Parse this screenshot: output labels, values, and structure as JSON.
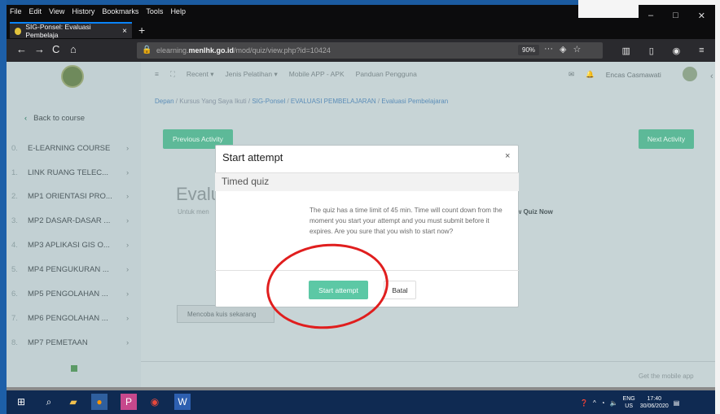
{
  "menubar": [
    "File",
    "Edit",
    "View",
    "History",
    "Bookmarks",
    "Tools",
    "Help"
  ],
  "tab": {
    "title": "SIG-Ponsel: Evaluasi Pembelaja",
    "close": "×"
  },
  "newtab": "+",
  "nav": {
    "back": "←",
    "forward": "→",
    "reload": "C",
    "home": "⌂"
  },
  "url": {
    "prefix": "elearning.",
    "domain": "menlhk.go.id",
    "path": "/mod/quiz/view.php?id=10424",
    "zoom": "90%",
    "more": "···"
  },
  "sidebar": {
    "back": "Back to course",
    "items": [
      {
        "num": "0.",
        "label": "E-LEARNING COURSE"
      },
      {
        "num": "1.",
        "label": "LINK RUANG TELEC..."
      },
      {
        "num": "2.",
        "label": "MP1 ORIENTASI PRO..."
      },
      {
        "num": "3.",
        "label": "MP2 DASAR-DASAR ..."
      },
      {
        "num": "4.",
        "label": "MP3 APLIKASI GIS O..."
      },
      {
        "num": "5.",
        "label": "MP4 PENGUKURAN ..."
      },
      {
        "num": "6.",
        "label": "MP5 PENGOLAHAN ..."
      },
      {
        "num": "7.",
        "label": "MP6 PENGOLAHAN ..."
      },
      {
        "num": "8.",
        "label": "MP7 PEMETAAN"
      }
    ]
  },
  "topnav": [
    "Recent ▾",
    "Jenis Pelatihan ▾",
    "Mobile APP - APK",
    "Panduan Pengguna"
  ],
  "user": {
    "name": "Encas Casmawati"
  },
  "breadcrumb": {
    "home": "Depan",
    "courses": "Kursus Yang Saya Ikuti",
    "course": "SIG-Ponsel",
    "section": "EVALUASI PEMBELAJARAN",
    "page": "Evaluasi Pembelajaran"
  },
  "buttons": {
    "previous": "Previous Activity",
    "next": "Next Activity"
  },
  "background": {
    "heading": "Evalu",
    "sub": "Untuk men",
    "review": "w Quiz Now",
    "attempt_btn": "Mencoba kuis sekarang",
    "get_mobile": "Get the mobile app"
  },
  "modal": {
    "title": "Start attempt",
    "close": "×",
    "subheading": "Timed quiz",
    "text": "The quiz has a time limit of 45 min. Time will count down from the moment you start your attempt and you must submit before it expires. Are you sure that you wish to start now?",
    "start": "Start attempt",
    "cancel": "Batal"
  },
  "tray": {
    "lang1": "ENG",
    "lang2": "US",
    "time": "17:40",
    "date": "30/06/2020"
  }
}
